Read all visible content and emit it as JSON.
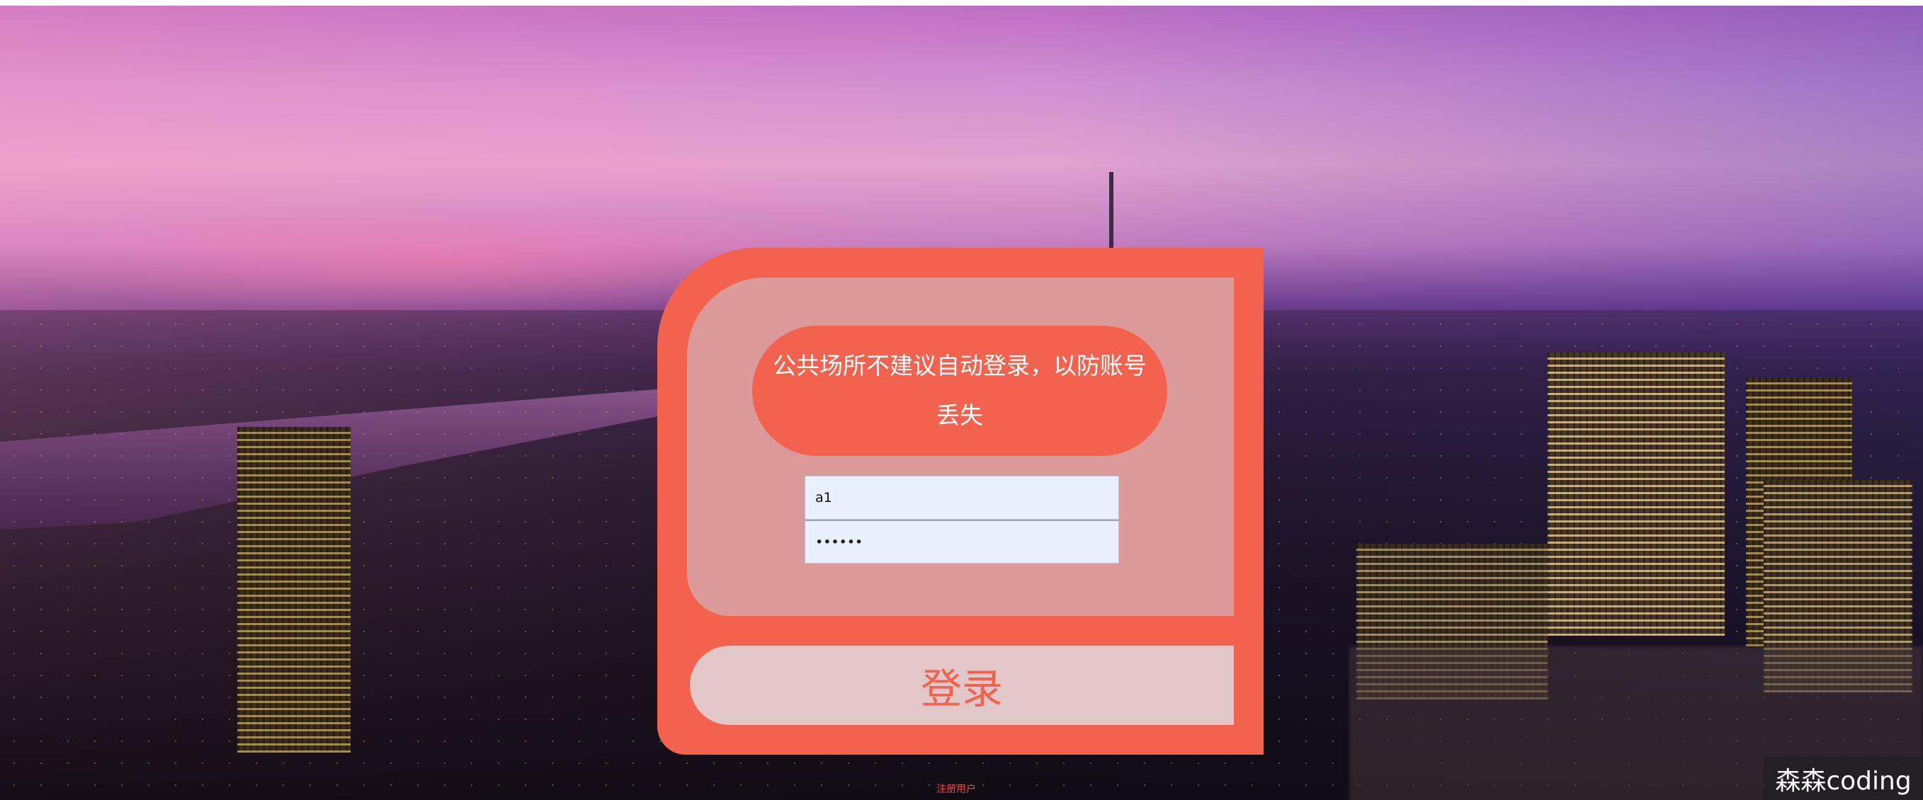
{
  "login": {
    "notice": "公共场所不建议自动登录，以防账号丢失",
    "username_value": "a1",
    "password_value": "••••••",
    "submit_label": "登录",
    "register_label": "注册用户"
  },
  "watermark": {
    "text": "森森coding"
  },
  "colors": {
    "accent": "#f2624e",
    "input_bg": "#e8f0fe"
  }
}
